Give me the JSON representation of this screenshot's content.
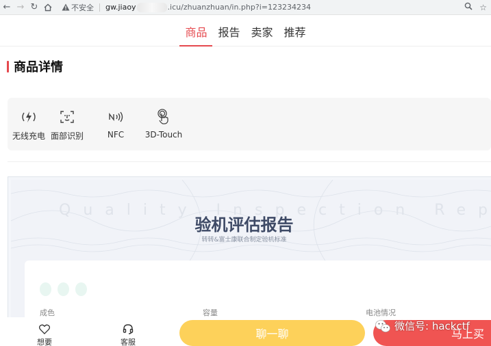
{
  "browser": {
    "security_label": "不安全",
    "url_host": "gw.jiaoy",
    "url_tail": ".icu/zhuanzhuan/in.php?i=123234234"
  },
  "tabs": [
    {
      "label": "商品",
      "active": true
    },
    {
      "label": "报告"
    },
    {
      "label": "卖家"
    },
    {
      "label": "推荐"
    }
  ],
  "section": {
    "title": "商品详情"
  },
  "features": [
    {
      "icon": "wireless-charging-icon",
      "label": "无线充电"
    },
    {
      "icon": "face-id-icon",
      "label": "面部识别"
    },
    {
      "icon": "nfc-icon",
      "label": "NFC"
    },
    {
      "icon": "3d-touch-icon",
      "label": "3D-Touch"
    }
  ],
  "report": {
    "bg_text": "Quality Inspection Report",
    "title": "验机评估报告",
    "subtitle": "转转&富士康联合制定验机标准",
    "specs": [
      "成色",
      "容量",
      "电池情况"
    ]
  },
  "bottom": {
    "favorite_label": "想要",
    "service_label": "客服",
    "chat_label": "聊一聊",
    "buy_label": "马上买"
  },
  "watermark": {
    "text": "微信号: hackctf"
  },
  "colors": {
    "accent": "#e5484d",
    "chat": "#fdd15a",
    "buy": "#f05452"
  }
}
